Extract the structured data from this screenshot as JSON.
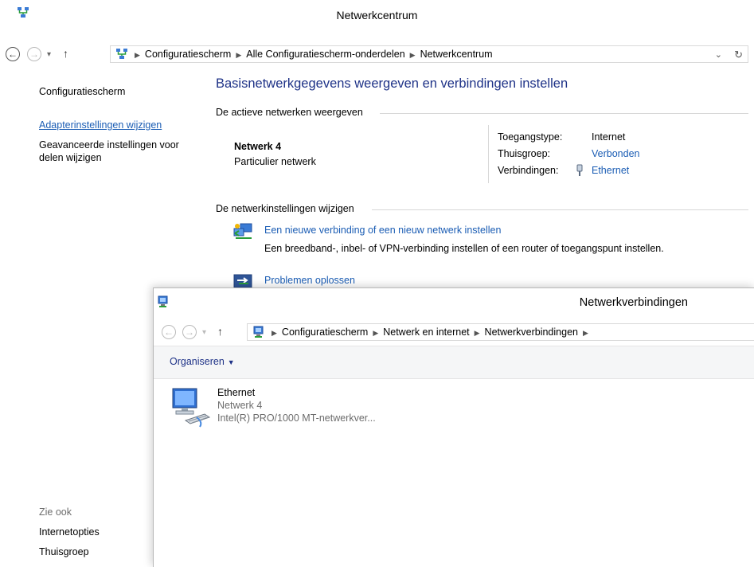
{
  "window1": {
    "title": "Netwerkcentrum",
    "breadcrumb": [
      "Configuratiescherm",
      "Alle Configuratiescherm-onderdelen",
      "Netwerkcentrum"
    ],
    "nav": {
      "back": "←",
      "forward": "→",
      "up": "↑",
      "dropdown": "▾",
      "history": "⌄",
      "refresh": "↻"
    },
    "leftnav": {
      "home": "Configuratiescherm",
      "items": [
        "Adapterinstellingen wijzigen",
        "Geavanceerde instellingen voor delen wijzigen"
      ],
      "see_also_label": "Zie ook",
      "see_also": [
        "Internetopties",
        "Thuisgroep"
      ]
    },
    "heading": "Basisnetwerkgegevens weergeven en verbindingen instellen",
    "active_section": "De actieve netwerken weergeven",
    "network": {
      "name": "Netwerk 4",
      "type": "Particulier netwerk",
      "access_type_label": "Toegangstype:",
      "access_type_value": "Internet",
      "homegroup_label": "Thuisgroep:",
      "homegroup_value": "Verbonden",
      "connections_label": "Verbindingen:",
      "connections_value": "Ethernet"
    },
    "change_section": "De netwerkinstellingen wijzigen",
    "tasks": [
      {
        "link": "Een nieuwe verbinding of een nieuw netwerk instellen",
        "desc": "Een breedband-, inbel- of VPN-verbinding instellen of een router of toegangspunt instellen."
      },
      {
        "link": "Problemen oplossen"
      }
    ]
  },
  "window2": {
    "title": "Netwerkverbindingen",
    "breadcrumb": [
      "Configuratiescherm",
      "Netwerk en internet",
      "Netwerkverbindingen"
    ],
    "toolbar": {
      "organize": "Organiseren",
      "organize_caret": "▼"
    },
    "adapter": {
      "name": "Ethernet",
      "network": "Netwerk 4",
      "device": "Intel(R) PRO/1000 MT-netwerkver..."
    }
  },
  "colors": {
    "link": "#1b5db4",
    "heading": "#1e3287",
    "muted": "#6d6d6d"
  }
}
